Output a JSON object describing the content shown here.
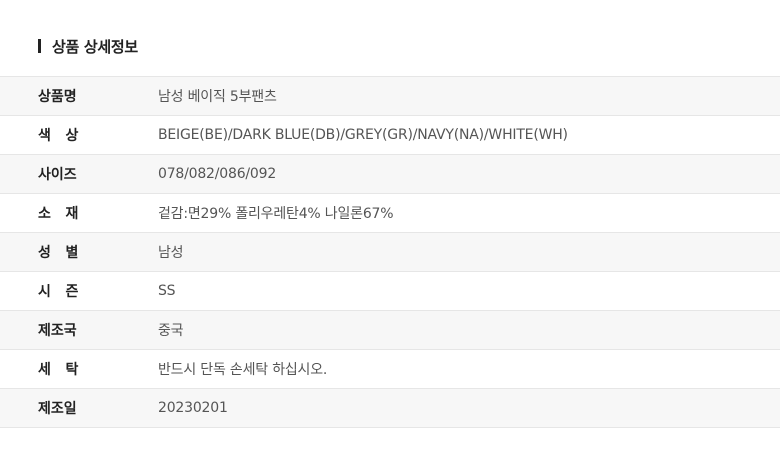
{
  "section": {
    "title": "상품 상세정보"
  },
  "specs": [
    {
      "label": "상품명",
      "value": "남성 베이직 5부팬츠"
    },
    {
      "label": "색   상",
      "value": "BEIGE(BE)/DARK BLUE(DB)/GREY(GR)/NAVY(NA)/WHITE(WH)"
    },
    {
      "label": "사이즈",
      "value": "078/082/086/092"
    },
    {
      "label": "소   재",
      "value": "겉감:면29% 폴리우레탄4% 나일론67%"
    },
    {
      "label": "성   별",
      "value": "남성"
    },
    {
      "label": "시   즌",
      "value": "SS"
    },
    {
      "label": "제조국",
      "value": "중국"
    },
    {
      "label": "세   탁",
      "value": "반드시 단독 손세탁 하십시오."
    },
    {
      "label": "제조일",
      "value": "20230201"
    }
  ],
  "colors": {
    "text_dark": "#222222",
    "text_value": "#555555",
    "row_alt": "#f7f7f7",
    "border": "#e6e6e6"
  }
}
